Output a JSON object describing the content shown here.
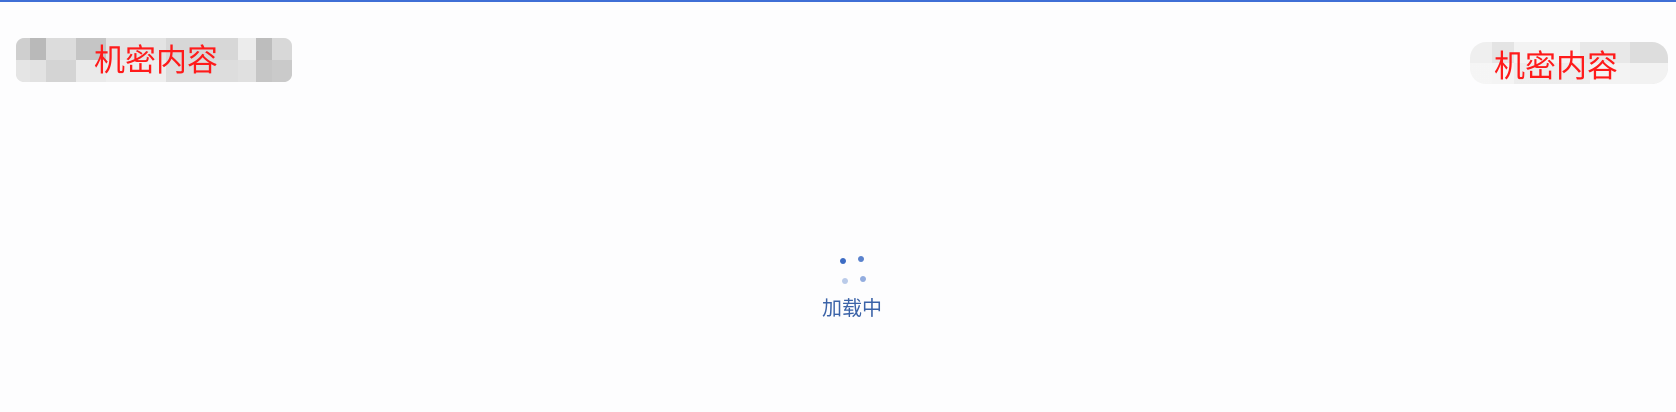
{
  "header": {
    "left_redaction_label": "机密内容",
    "right_redaction_label": "机密内容"
  },
  "loading": {
    "text": "加载中",
    "spinner_icon": "loading-spinner-icon"
  },
  "colors": {
    "accent": "#3f6fd6",
    "redaction_label": "#ff1a1a",
    "loading_text": "#3b63a8",
    "background": "#fdfdfe"
  }
}
